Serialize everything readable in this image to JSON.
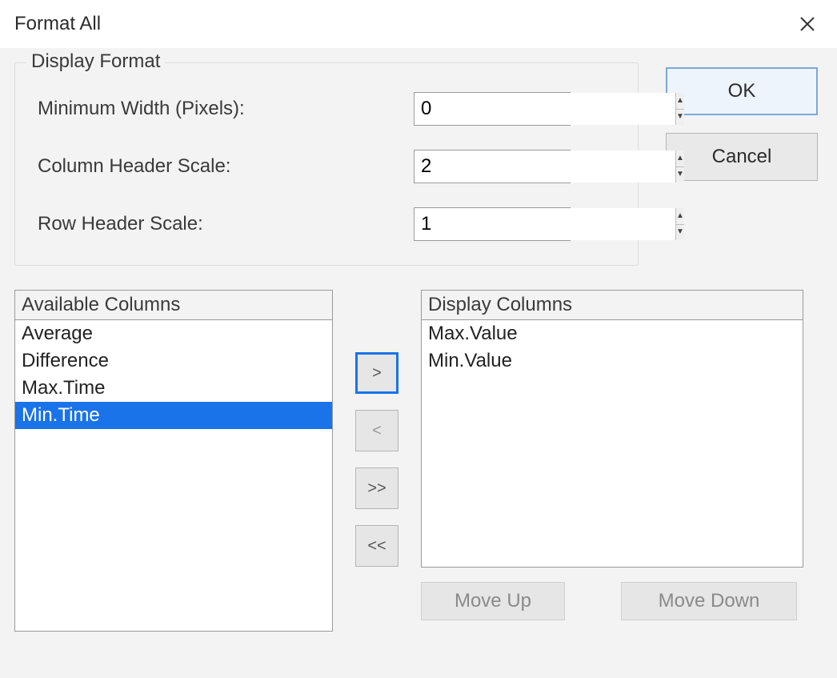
{
  "window": {
    "title": "Format All"
  },
  "group": {
    "legend": "Display Format",
    "min_width_label": "Minimum Width (Pixels):",
    "min_width_value": "0",
    "col_header_scale_label": "Column Header Scale:",
    "col_header_scale_value": "2",
    "row_header_scale_label": "Row Header Scale:",
    "row_header_scale_value": "1"
  },
  "buttons": {
    "ok": "OK",
    "cancel": "Cancel",
    "add": ">",
    "remove": "<",
    "add_all": ">>",
    "remove_all": "<<",
    "move_up": "Move Up",
    "move_down": "Move Down"
  },
  "lists": {
    "available_label": "Available Columns",
    "available_items": [
      "Average",
      "Difference",
      "Max.Time",
      "Min.Time"
    ],
    "available_selected_index": 3,
    "display_label": "Display Columns",
    "display_items": [
      "Max.Value",
      "Min.Value"
    ]
  }
}
